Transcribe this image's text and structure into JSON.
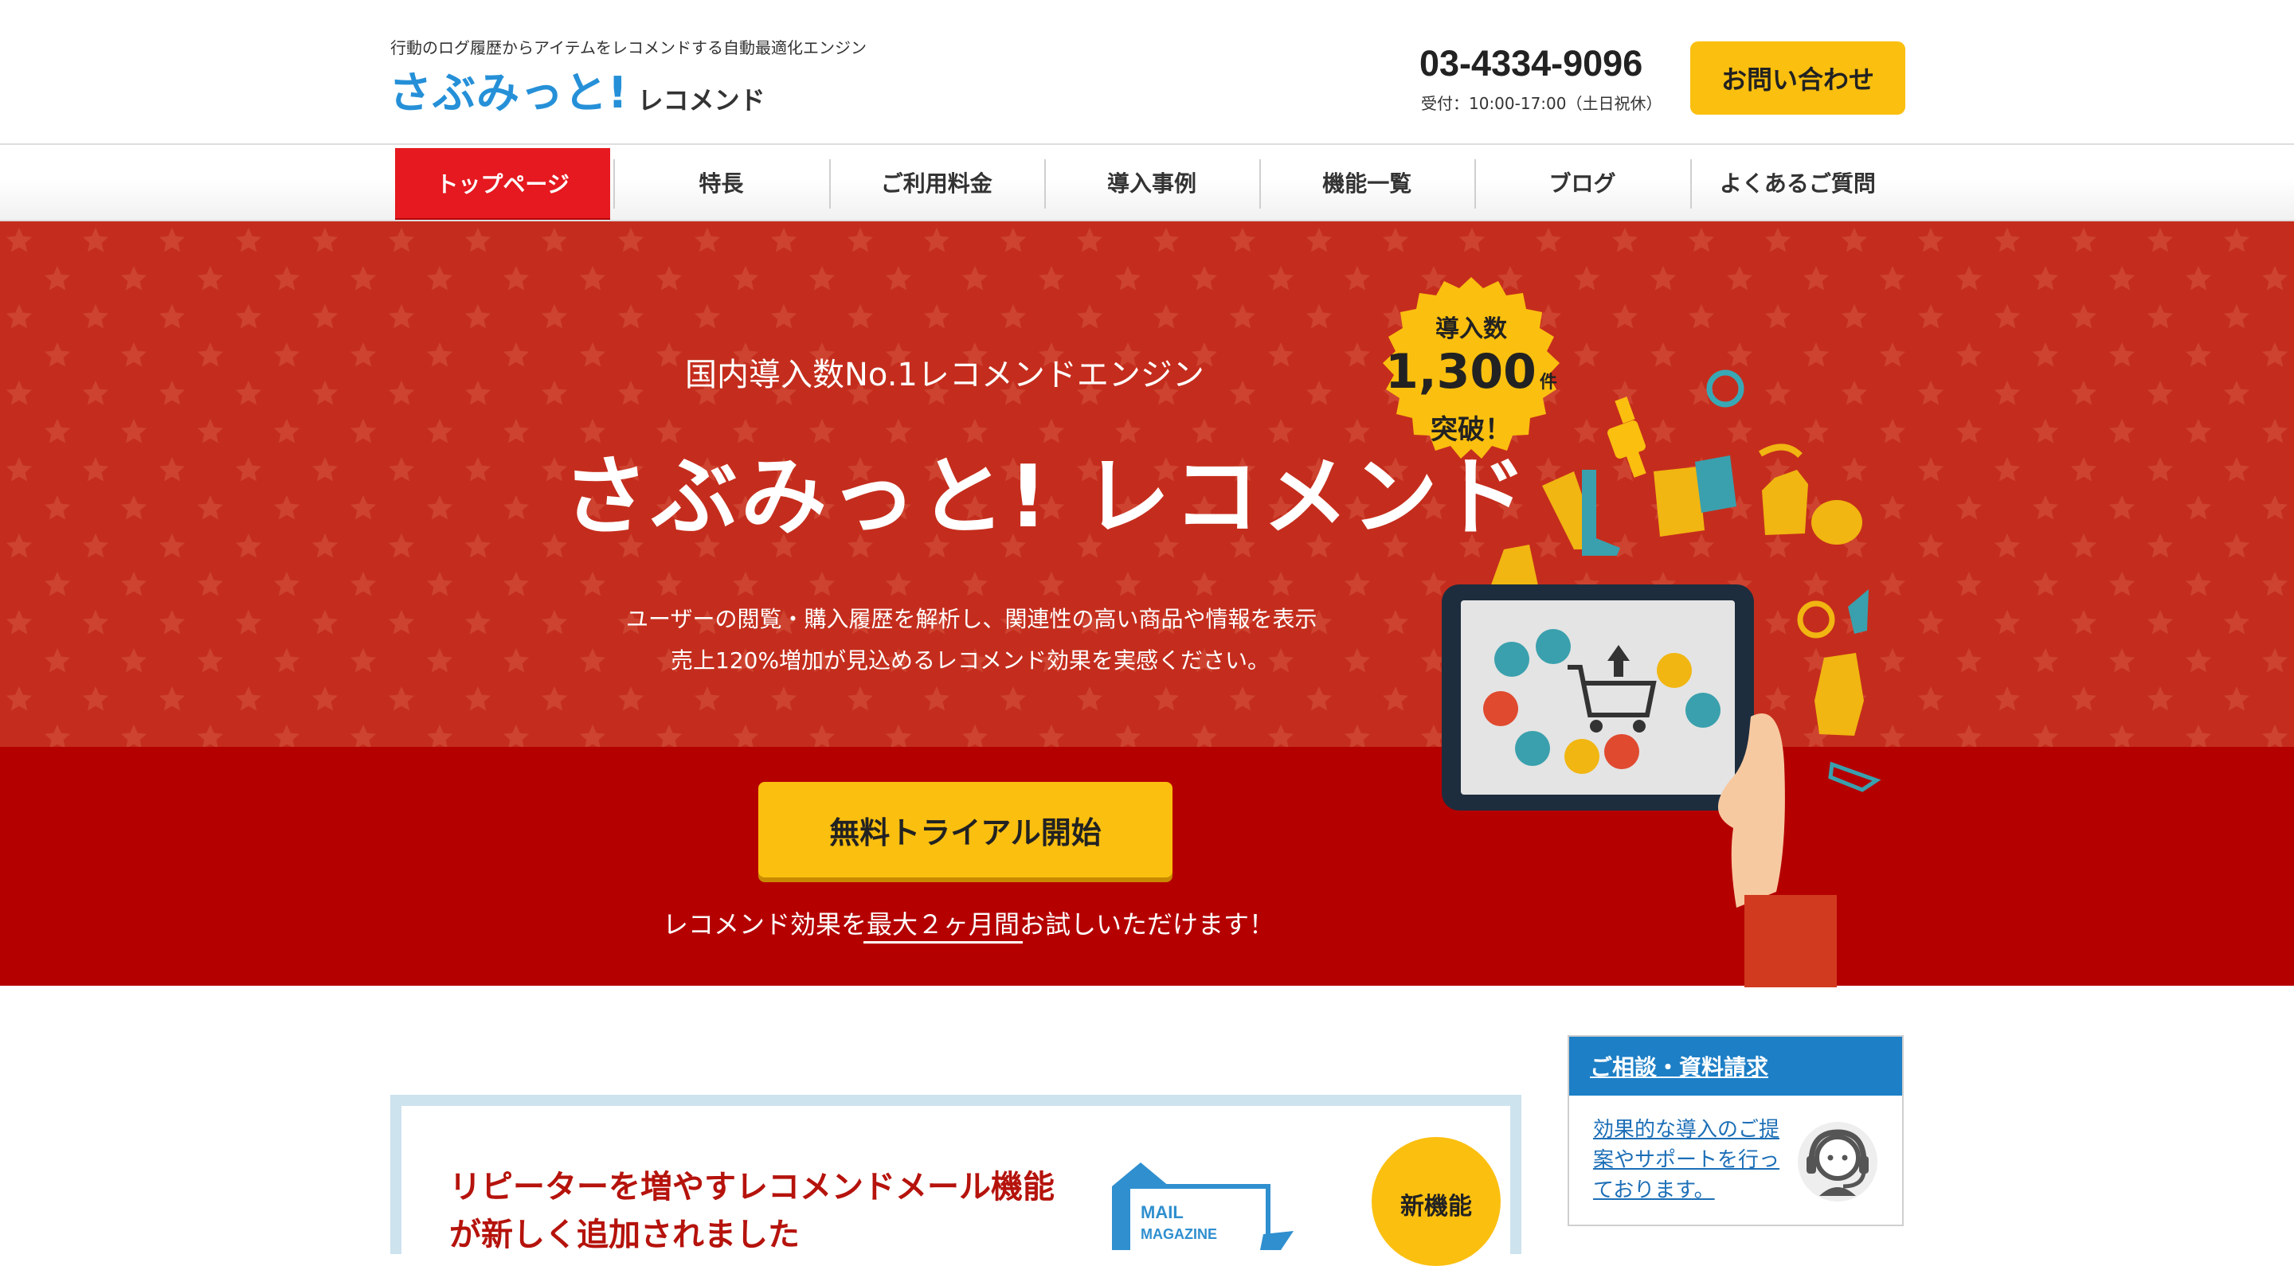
{
  "header": {
    "tagline": "行動のログ履歴からアイテムをレコメンドする自動最適化エンジン",
    "logo_main": "さぶみっと!",
    "logo_sub": "レコメンド",
    "phone": "03-4334-9096",
    "hours": "受付：10:00-17:00（土日祝休）",
    "contact_label": "お問い合わせ"
  },
  "nav": {
    "items": [
      {
        "label": "トップページ",
        "active": true
      },
      {
        "label": "特長"
      },
      {
        "label": "ご利用料金"
      },
      {
        "label": "導入事例"
      },
      {
        "label": "機能一覧"
      },
      {
        "label": "ブログ"
      },
      {
        "label": "よくあるご質問"
      }
    ]
  },
  "hero": {
    "subtitle": "国内導入数No.1レコメンドエンジン",
    "title": "さぶみっと! レコメンド",
    "desc_line1": "ユーザーの閲覧・購入履歴を解析し、関連性の高い商品や情報を表示",
    "desc_line2": "売上120%増加が見込めるレコメンド効果を実感ください。",
    "badge_label": "導入数",
    "badge_count": "1,300",
    "badge_unit": "件",
    "badge_break": "突破！",
    "trial_label": "無料トライアル開始",
    "note": "レコメンド効果を最大２ヶ月間お試しいただけます！"
  },
  "feature": {
    "line1": "リピーターを増やすレコメンドメール機能",
    "line2": "が新しく追加されました",
    "mail_label": "MAIL",
    "mail_label2": "MAGAZINE",
    "new_badge": "新機能"
  },
  "side": {
    "heading": "ご相談・資料請求",
    "text": "効果的な導入のご提案やサポートを行っております。",
    "icon": "support-headset-icon"
  },
  "colors": {
    "brand_blue": "#2590d8",
    "accent_yellow": "#fbbf0f",
    "hero_red": "#c42d1d",
    "hero_dark_red": "#b50000",
    "nav_active": "#e5191f"
  }
}
